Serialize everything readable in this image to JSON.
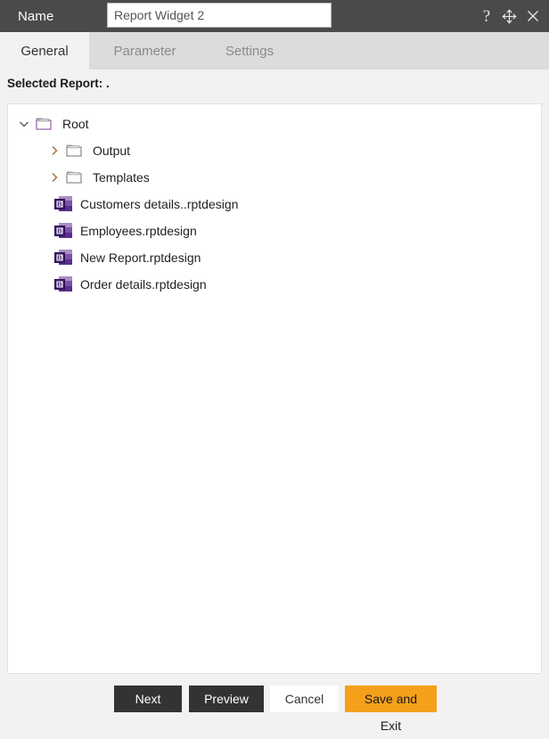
{
  "header": {
    "name_label": "Name",
    "name_value": "Report Widget 2",
    "name_placeholder": "Name",
    "help_icon": "question-mark-icon",
    "move_icon": "move-arrows-icon",
    "close_icon": "close-x-icon",
    "background_color": "#4a4a4a"
  },
  "tabs": [
    {
      "label": "General",
      "active": true
    },
    {
      "label": "Parameter",
      "active": false
    },
    {
      "label": "Settings",
      "active": false
    }
  ],
  "selected_report": {
    "text": "Selected Report: ."
  },
  "tree": {
    "items": [
      {
        "label": "Root",
        "type": "folder",
        "depth": 0,
        "expanded": true,
        "chevron": "chevron-down-icon"
      },
      {
        "label": "Output",
        "type": "folder",
        "depth": 1,
        "expanded": false,
        "chevron": "chevron-right-icon"
      },
      {
        "label": "Templates",
        "type": "folder",
        "depth": 1,
        "expanded": false,
        "chevron": "chevron-right-icon"
      },
      {
        "label": "Customers details..rptdesign",
        "type": "file",
        "depth": 1,
        "icon": "birt-report-file-icon"
      },
      {
        "label": "Employees.rptdesign",
        "type": "file",
        "depth": 1,
        "icon": "birt-report-file-icon"
      },
      {
        "label": "New Report.rptdesign",
        "type": "file",
        "depth": 1,
        "icon": "birt-report-file-icon"
      },
      {
        "label": "Order details.rptdesign",
        "type": "file",
        "depth": 1,
        "icon": "birt-report-file-icon"
      }
    ]
  },
  "footer": {
    "buttons": [
      {
        "label": "Next",
        "style": "dark"
      },
      {
        "label": "Preview",
        "style": "dark"
      },
      {
        "label": "Cancel",
        "style": "light"
      },
      {
        "label": "Save and Exit",
        "style": "accent"
      }
    ]
  },
  "colors": {
    "header_bg": "#4a4a4a",
    "tabstrip_bg": "#dcdcdc",
    "page_bg": "#f2f2f2",
    "accent_orange": "#f5a01b",
    "dark_button": "#333333",
    "file_icon_purple": "#5b2d8e"
  }
}
